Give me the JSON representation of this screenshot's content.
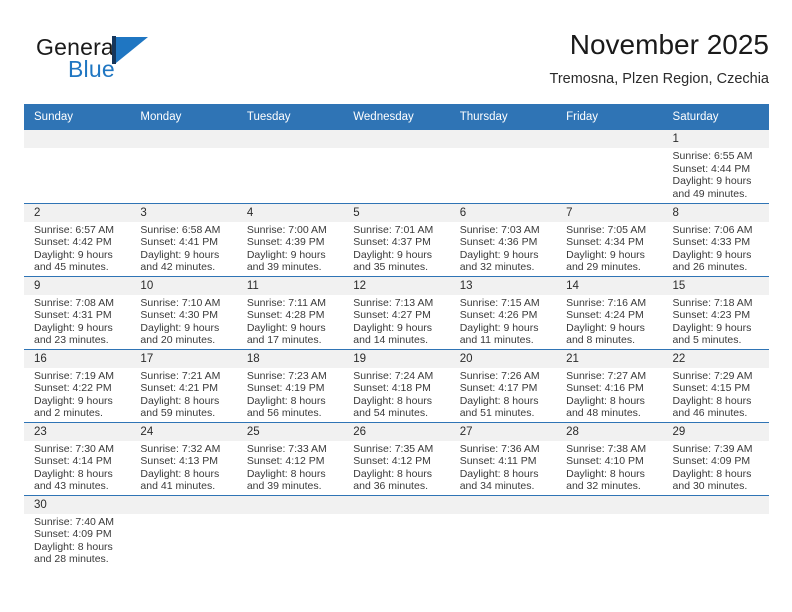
{
  "brand": {
    "word_one": "General",
    "word_two": "Blue",
    "logo_icon": "triangle-logo-icon"
  },
  "header": {
    "title": "November 2025",
    "subtitle": "Tremosna, Plzen Region, Czechia"
  },
  "calendar": {
    "weekday_headers": [
      "Sunday",
      "Monday",
      "Tuesday",
      "Wednesday",
      "Thursday",
      "Friday",
      "Saturday"
    ],
    "accent_color": "#2f74b5",
    "daynum_band_color": "#f1f1f1",
    "weeks": [
      [
        {
          "empty": true
        },
        {
          "empty": true
        },
        {
          "empty": true
        },
        {
          "empty": true
        },
        {
          "empty": true
        },
        {
          "empty": true
        },
        {
          "day": "1",
          "sunrise": "Sunrise: 6:55 AM",
          "sunset": "Sunset: 4:44 PM",
          "daylight_line1": "Daylight: 9 hours",
          "daylight_line2": "and 49 minutes."
        }
      ],
      [
        {
          "day": "2",
          "sunrise": "Sunrise: 6:57 AM",
          "sunset": "Sunset: 4:42 PM",
          "daylight_line1": "Daylight: 9 hours",
          "daylight_line2": "and 45 minutes."
        },
        {
          "day": "3",
          "sunrise": "Sunrise: 6:58 AM",
          "sunset": "Sunset: 4:41 PM",
          "daylight_line1": "Daylight: 9 hours",
          "daylight_line2": "and 42 minutes."
        },
        {
          "day": "4",
          "sunrise": "Sunrise: 7:00 AM",
          "sunset": "Sunset: 4:39 PM",
          "daylight_line1": "Daylight: 9 hours",
          "daylight_line2": "and 39 minutes."
        },
        {
          "day": "5",
          "sunrise": "Sunrise: 7:01 AM",
          "sunset": "Sunset: 4:37 PM",
          "daylight_line1": "Daylight: 9 hours",
          "daylight_line2": "and 35 minutes."
        },
        {
          "day": "6",
          "sunrise": "Sunrise: 7:03 AM",
          "sunset": "Sunset: 4:36 PM",
          "daylight_line1": "Daylight: 9 hours",
          "daylight_line2": "and 32 minutes."
        },
        {
          "day": "7",
          "sunrise": "Sunrise: 7:05 AM",
          "sunset": "Sunset: 4:34 PM",
          "daylight_line1": "Daylight: 9 hours",
          "daylight_line2": "and 29 minutes."
        },
        {
          "day": "8",
          "sunrise": "Sunrise: 7:06 AM",
          "sunset": "Sunset: 4:33 PM",
          "daylight_line1": "Daylight: 9 hours",
          "daylight_line2": "and 26 minutes."
        }
      ],
      [
        {
          "day": "9",
          "sunrise": "Sunrise: 7:08 AM",
          "sunset": "Sunset: 4:31 PM",
          "daylight_line1": "Daylight: 9 hours",
          "daylight_line2": "and 23 minutes."
        },
        {
          "day": "10",
          "sunrise": "Sunrise: 7:10 AM",
          "sunset": "Sunset: 4:30 PM",
          "daylight_line1": "Daylight: 9 hours",
          "daylight_line2": "and 20 minutes."
        },
        {
          "day": "11",
          "sunrise": "Sunrise: 7:11 AM",
          "sunset": "Sunset: 4:28 PM",
          "daylight_line1": "Daylight: 9 hours",
          "daylight_line2": "and 17 minutes."
        },
        {
          "day": "12",
          "sunrise": "Sunrise: 7:13 AM",
          "sunset": "Sunset: 4:27 PM",
          "daylight_line1": "Daylight: 9 hours",
          "daylight_line2": "and 14 minutes."
        },
        {
          "day": "13",
          "sunrise": "Sunrise: 7:15 AM",
          "sunset": "Sunset: 4:26 PM",
          "daylight_line1": "Daylight: 9 hours",
          "daylight_line2": "and 11 minutes."
        },
        {
          "day": "14",
          "sunrise": "Sunrise: 7:16 AM",
          "sunset": "Sunset: 4:24 PM",
          "daylight_line1": "Daylight: 9 hours",
          "daylight_line2": "and 8 minutes."
        },
        {
          "day": "15",
          "sunrise": "Sunrise: 7:18 AM",
          "sunset": "Sunset: 4:23 PM",
          "daylight_line1": "Daylight: 9 hours",
          "daylight_line2": "and 5 minutes."
        }
      ],
      [
        {
          "day": "16",
          "sunrise": "Sunrise: 7:19 AM",
          "sunset": "Sunset: 4:22 PM",
          "daylight_line1": "Daylight: 9 hours",
          "daylight_line2": "and 2 minutes."
        },
        {
          "day": "17",
          "sunrise": "Sunrise: 7:21 AM",
          "sunset": "Sunset: 4:21 PM",
          "daylight_line1": "Daylight: 8 hours",
          "daylight_line2": "and 59 minutes."
        },
        {
          "day": "18",
          "sunrise": "Sunrise: 7:23 AM",
          "sunset": "Sunset: 4:19 PM",
          "daylight_line1": "Daylight: 8 hours",
          "daylight_line2": "and 56 minutes."
        },
        {
          "day": "19",
          "sunrise": "Sunrise: 7:24 AM",
          "sunset": "Sunset: 4:18 PM",
          "daylight_line1": "Daylight: 8 hours",
          "daylight_line2": "and 54 minutes."
        },
        {
          "day": "20",
          "sunrise": "Sunrise: 7:26 AM",
          "sunset": "Sunset: 4:17 PM",
          "daylight_line1": "Daylight: 8 hours",
          "daylight_line2": "and 51 minutes."
        },
        {
          "day": "21",
          "sunrise": "Sunrise: 7:27 AM",
          "sunset": "Sunset: 4:16 PM",
          "daylight_line1": "Daylight: 8 hours",
          "daylight_line2": "and 48 minutes."
        },
        {
          "day": "22",
          "sunrise": "Sunrise: 7:29 AM",
          "sunset": "Sunset: 4:15 PM",
          "daylight_line1": "Daylight: 8 hours",
          "daylight_line2": "and 46 minutes."
        }
      ],
      [
        {
          "day": "23",
          "sunrise": "Sunrise: 7:30 AM",
          "sunset": "Sunset: 4:14 PM",
          "daylight_line1": "Daylight: 8 hours",
          "daylight_line2": "and 43 minutes."
        },
        {
          "day": "24",
          "sunrise": "Sunrise: 7:32 AM",
          "sunset": "Sunset: 4:13 PM",
          "daylight_line1": "Daylight: 8 hours",
          "daylight_line2": "and 41 minutes."
        },
        {
          "day": "25",
          "sunrise": "Sunrise: 7:33 AM",
          "sunset": "Sunset: 4:12 PM",
          "daylight_line1": "Daylight: 8 hours",
          "daylight_line2": "and 39 minutes."
        },
        {
          "day": "26",
          "sunrise": "Sunrise: 7:35 AM",
          "sunset": "Sunset: 4:12 PM",
          "daylight_line1": "Daylight: 8 hours",
          "daylight_line2": "and 36 minutes."
        },
        {
          "day": "27",
          "sunrise": "Sunrise: 7:36 AM",
          "sunset": "Sunset: 4:11 PM",
          "daylight_line1": "Daylight: 8 hours",
          "daylight_line2": "and 34 minutes."
        },
        {
          "day": "28",
          "sunrise": "Sunrise: 7:38 AM",
          "sunset": "Sunset: 4:10 PM",
          "daylight_line1": "Daylight: 8 hours",
          "daylight_line2": "and 32 minutes."
        },
        {
          "day": "29",
          "sunrise": "Sunrise: 7:39 AM",
          "sunset": "Sunset: 4:09 PM",
          "daylight_line1": "Daylight: 8 hours",
          "daylight_line2": "and 30 minutes."
        }
      ],
      [
        {
          "day": "30",
          "sunrise": "Sunrise: 7:40 AM",
          "sunset": "Sunset: 4:09 PM",
          "daylight_line1": "Daylight: 8 hours",
          "daylight_line2": "and 28 minutes."
        },
        {
          "empty": true
        },
        {
          "empty": true
        },
        {
          "empty": true
        },
        {
          "empty": true
        },
        {
          "empty": true
        },
        {
          "empty": true
        }
      ]
    ]
  }
}
